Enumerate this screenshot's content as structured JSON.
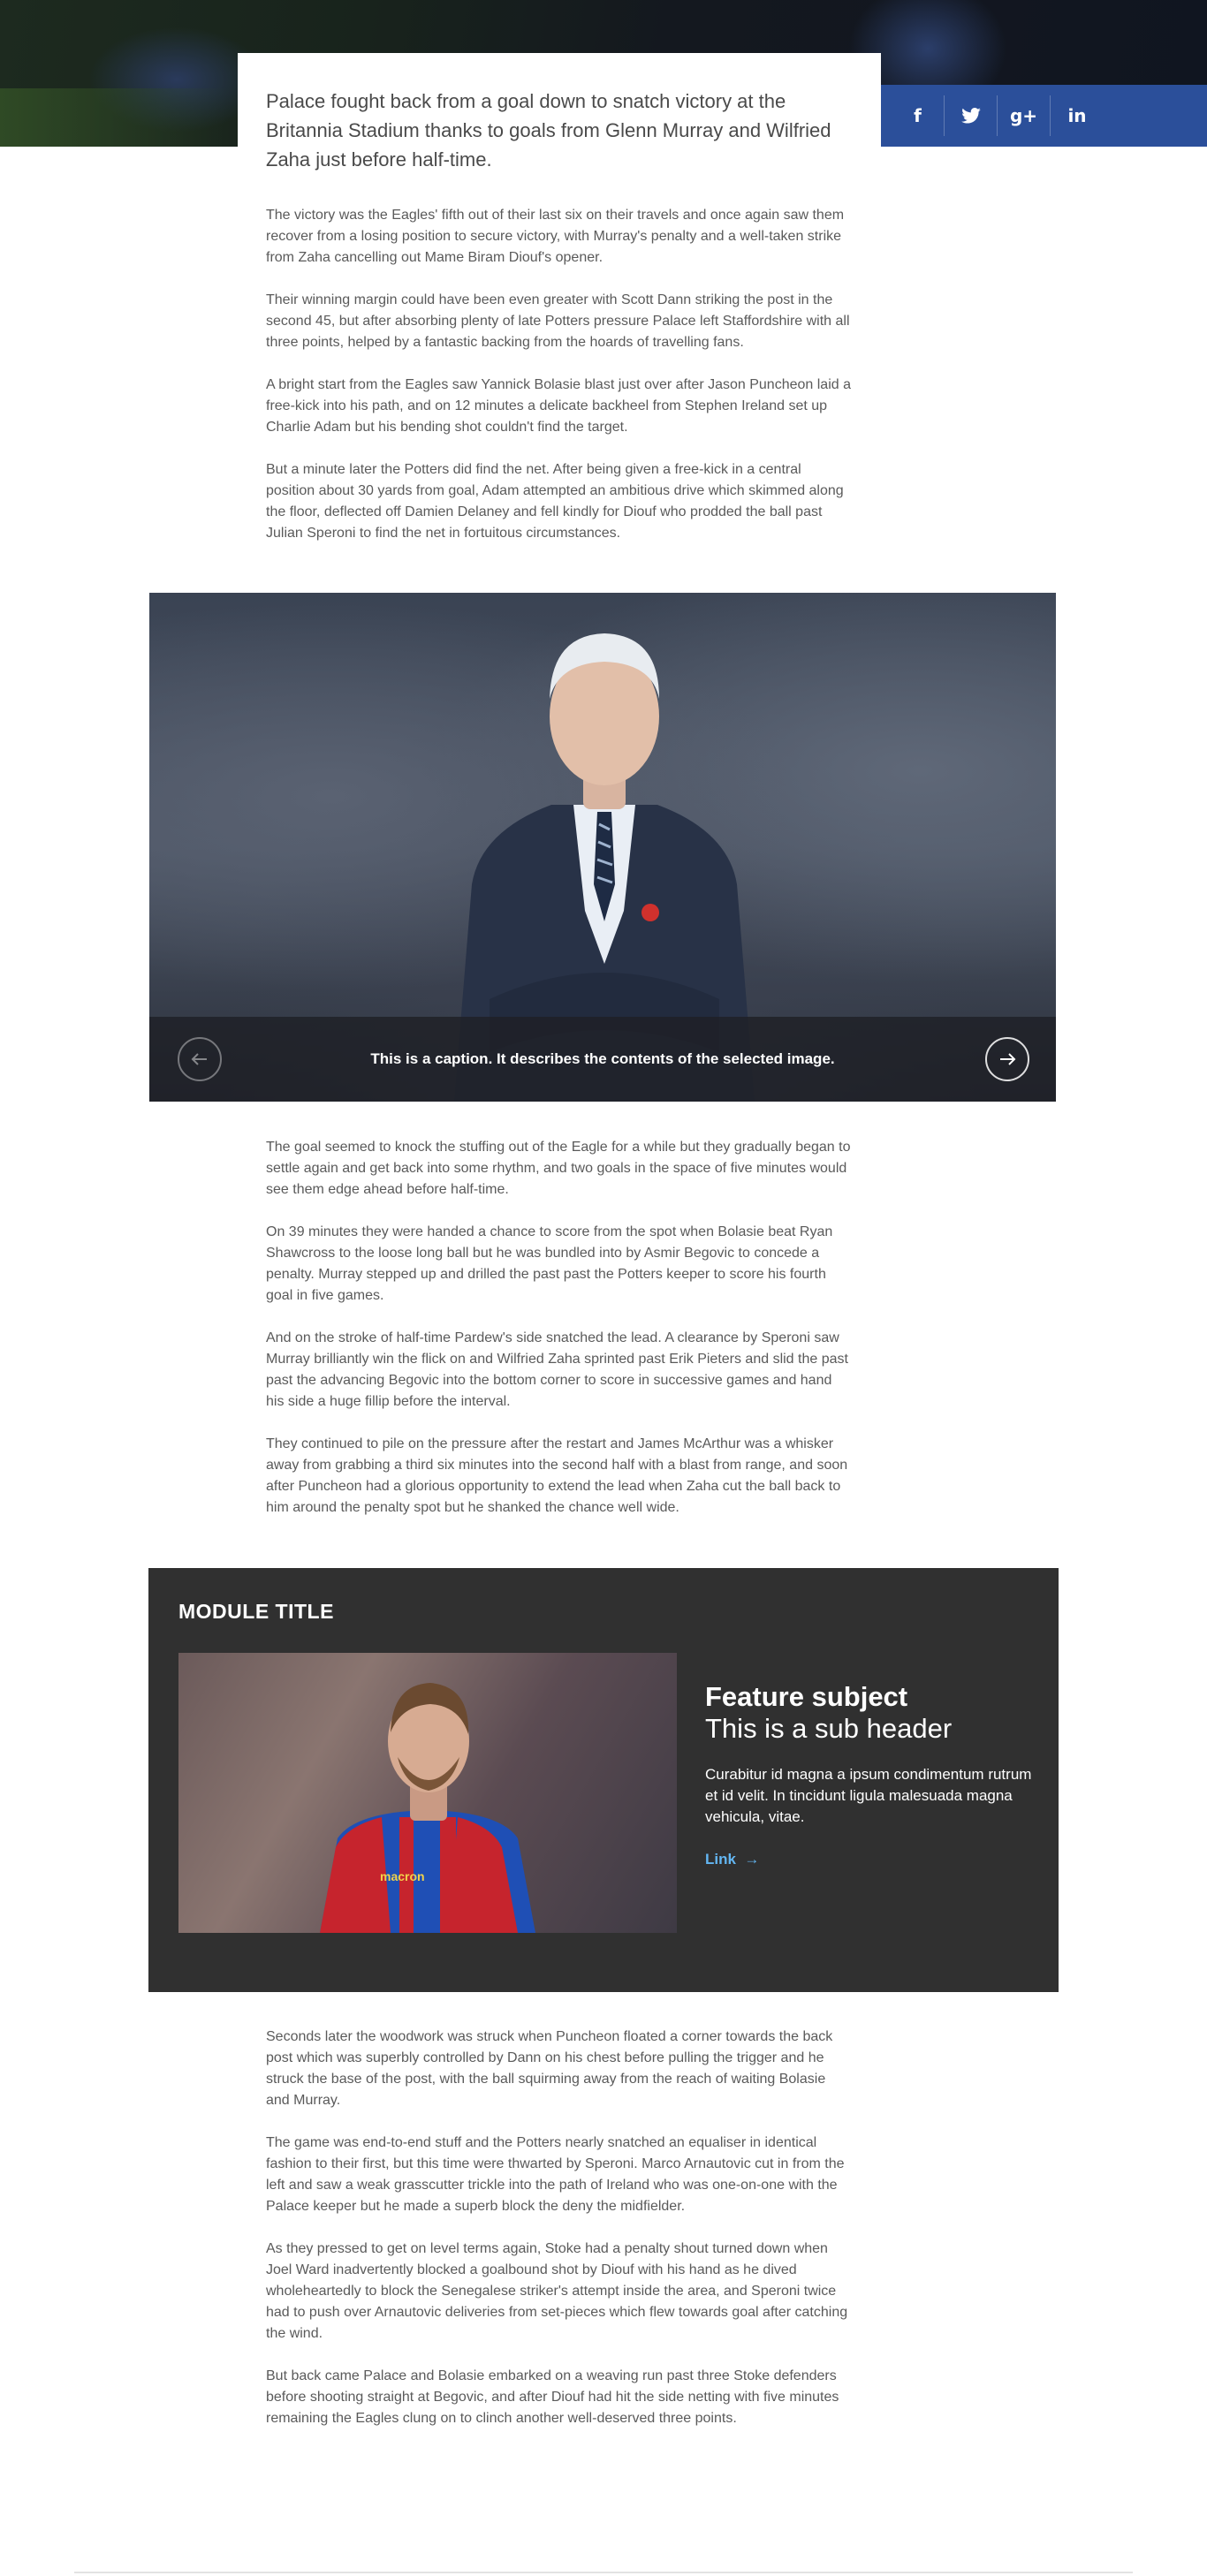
{
  "social": {
    "facebook": "f",
    "twitter": "🐦",
    "googleplus": "g+",
    "linkedin": "in"
  },
  "lead": "Palace fought back from a goal down to snatch victory at the Britannia Stadium thanks to goals from Glenn Murray and Wilfried Zaha just before half-time.",
  "article_part1": [
    "The victory was the Eagles' fifth out of their last six on their travels and once again saw them recover from a losing position to secure victory, with Murray's penalty and a well-taken strike from Zaha cancelling out Mame Biram Diouf's opener.",
    "Their winning margin could have been even greater with Scott Dann striking the post in the second 45, but after absorbing plenty of late Potters pressure Palace left Staffordshire with all three points, helped by a fantastic backing from the hoards of travelling fans.",
    "A bright start from the Eagles saw Yannick Bolasie blast just over after Jason Puncheon laid a free-kick into his path, and on 12 minutes a delicate backheel from Stephen Ireland set up Charlie Adam but his bending shot couldn't find the target.",
    "But a minute later the Potters did find the net. After being given a free-kick in a central position about 30 yards from goal, Adam attempted an ambitious drive which skimmed along the floor, deflected off Damien Delaney and fell kindly for Diouf who prodded the ball past Julian Speroni to find the net in fortuitous circumstances."
  ],
  "gallery": {
    "caption": "This is a caption. It describes the contents of the selected image.",
    "prev_icon": "arrow-left",
    "next_icon": "arrow-right"
  },
  "article_part2": [
    "The goal seemed to knock the stuffing out of the Eagle for a while but they gradually began to settle again and get back into some rhythm, and two goals in the space of five minutes would see them edge ahead before half-time.",
    "On 39 minutes they were handed a chance to score from the spot when Bolasie beat Ryan Shawcross to the loose long ball but he was bundled into by Asmir Begovic to concede a penalty. Murray stepped up and drilled the past past the Potters keeper to score his fourth goal in five games.",
    "And on the stroke of half-time Pardew's side snatched the lead. A clearance by Speroni saw Murray brilliantly win the flick on and Wilfried Zaha sprinted past Erik Pieters and slid the past past the advancing Begovic into the bottom corner to score in successive games and hand his side a huge fillip before the interval.",
    "They continued to pile on the pressure after the restart and James McArthur was a whisker away from grabbing a third six minutes into the second half with a blast from range, and soon after Puncheon had a glorious opportunity to extend the lead when Zaha cut the ball back to him around the penalty spot but he shanked the chance well wide."
  ],
  "module": {
    "title": "MODULE TITLE",
    "feature_subject": "Feature subject",
    "sub_header": "This is a sub header",
    "body": "Curabitur id magna a ipsum condimentum rutrum et id velit. In tincidunt ligula malesuada magna vehicula, vitae.",
    "link": "Link",
    "shirt_sponsor": "macron"
  },
  "article_part3": [
    "Seconds later the woodwork was struck when Puncheon floated a corner towards the back post which was superbly controlled by Dann on his chest before pulling the trigger and he struck the base of the post, with the ball squirming away from the reach of waiting Bolasie and Murray.",
    "The game was end-to-end stuff and the Potters nearly snatched an equaliser in identical fashion to their first, but this time were thwarted by Speroni. Marco Arnautovic cut in from the left and saw a weak grasscutter trickle into the path of Ireland who was one-on-one with the Palace keeper but he made a superb block the deny the midfielder.",
    "As they pressed to get on level terms again, Stoke had a penalty shout turned down when Joel Ward inadvertently blocked a goalbound shot by Diouf with his hand as he dived wholeheartedly to block the Senegalese striker's attempt inside the area, and Speroni twice had to push over Arnautovic deliveries from set-pieces which flew towards goal after catching the wind.",
    "But back came Palace and Bolasie embarked on a weaving run past three Stoke defenders before shooting straight at Begovic, and after Diouf had hit the side netting with five minutes remaining the Eagles clung on to clinch another well-deserved three points."
  ]
}
